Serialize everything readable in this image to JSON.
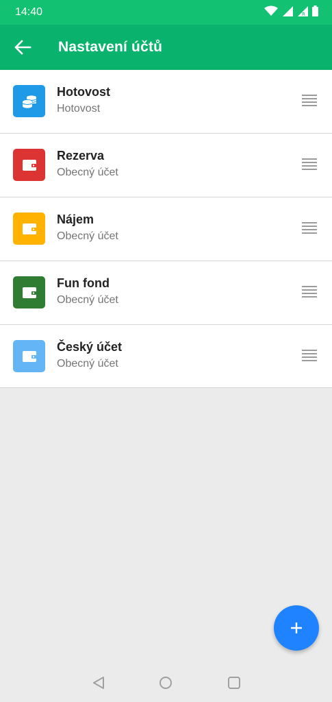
{
  "status_bar": {
    "time": "14:40",
    "icons": [
      "wifi-icon",
      "signal-icon",
      "signal-roaming-icon",
      "battery-icon"
    ],
    "color": "#13c172"
  },
  "app_bar": {
    "title": "Nastavení účtů",
    "back_icon": "arrow-back-icon",
    "color": "#09b36d"
  },
  "accounts": [
    {
      "name": "Hotovost",
      "type": "Hotovost",
      "icon": "coins-icon",
      "color": "#1e9ae6"
    },
    {
      "name": "Rezerva",
      "type": "Obecný účet",
      "icon": "wallet-icon",
      "color": "#dc3333"
    },
    {
      "name": "Nájem",
      "type": "Obecný účet",
      "icon": "wallet-icon",
      "color": "#ffb300"
    },
    {
      "name": "Fun fond",
      "type": "Obecný účet",
      "icon": "wallet-icon",
      "color": "#2e7d32"
    },
    {
      "name": "Český účet",
      "type": "Obecný účet",
      "icon": "wallet-icon",
      "color": "#64b5f6"
    }
  ],
  "fab": {
    "icon": "plus-icon",
    "color": "#1f82ff"
  },
  "nav_bar": {
    "buttons": [
      "back-triangle-icon",
      "home-circle-icon",
      "recents-square-icon"
    ]
  }
}
